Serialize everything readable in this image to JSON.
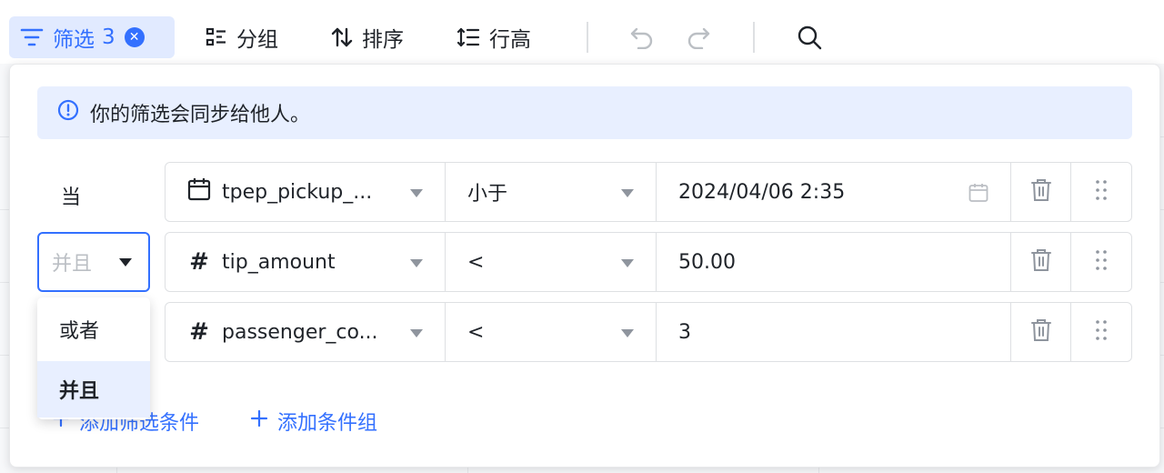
{
  "toolbar": {
    "filter_label": "筛选",
    "filter_count": "3",
    "group_label": "分组",
    "sort_label": "排序",
    "row_height_label": "行高"
  },
  "panel": {
    "notice": "你的筛选会同步给他人。",
    "when_label": "当",
    "conjunction": {
      "value": "并且",
      "options": [
        "或者",
        "并且"
      ]
    },
    "conditions": [
      {
        "field_type": "date",
        "field": "tpep_pickup_...",
        "operator": "小于",
        "value": "2024/04/06 2:35"
      },
      {
        "field_type": "number",
        "field": "tip_amount",
        "operator": "<",
        "value": "50.00"
      },
      {
        "field_type": "number",
        "field": "passenger_co...",
        "operator": "<",
        "value": "3"
      }
    ],
    "add_condition": "添加筛选条件",
    "add_group": "添加条件组"
  },
  "colors": {
    "accent": "#3370ff",
    "accent_bg": "#e1eaff",
    "notice_bg": "#e8efff"
  }
}
